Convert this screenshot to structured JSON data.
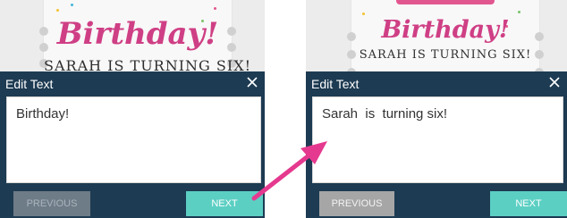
{
  "left": {
    "card": {
      "title": "Birthday!",
      "subtitle": "SARAH IS TURNING SIX!"
    },
    "dialog": {
      "title": "Edit Text",
      "text_value": "Birthday!",
      "previous_label": "PREVIOUS",
      "next_label": "NEXT"
    }
  },
  "right": {
    "card": {
      "title": "Birthday!",
      "subtitle": "SARAH IS TURNING SIX!"
    },
    "dialog": {
      "title": "Edit Text",
      "text_value": "Sarah  is  turning six!",
      "previous_label": "PREVIOUS",
      "next_label": "NEXT"
    }
  },
  "colors": {
    "dialog_bg": "#1d3b52",
    "next_button": "#5ccfc3",
    "arrow": "#e5398f",
    "card_title": "#cf3f85"
  },
  "icons": {
    "close": "close-icon",
    "arrow": "arrow-annotation"
  }
}
